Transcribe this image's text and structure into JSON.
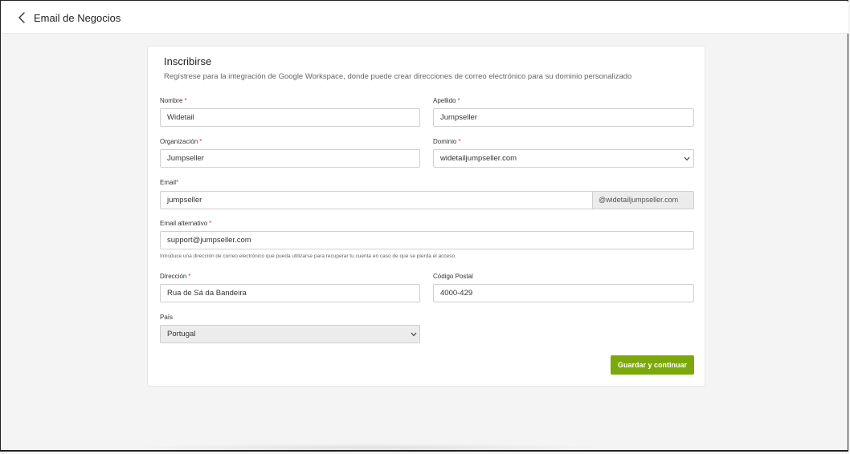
{
  "header": {
    "title": "Email de Negocios"
  },
  "form": {
    "title": "Inscribirse",
    "description": "Regístrese para la integración de Google Workspace, donde puede crear direcciones de correo electrónico para su dominio personalizado",
    "required_mark": "*",
    "fields": {
      "nombre": {
        "label": "Nombre",
        "value": "Widetail"
      },
      "apellido": {
        "label": "Apellido",
        "value": "Jumpseller"
      },
      "organizacion": {
        "label": "Organización",
        "value": "Jumpseller"
      },
      "dominio": {
        "label": "Dominio",
        "value": "widetailjumpseller.com"
      },
      "email": {
        "label": "Email",
        "value": "jumpseller",
        "suffix": "@widetailjumpseller.com"
      },
      "email_alternativo": {
        "label": "Email alternativo",
        "value": "support@jumpseller.com",
        "help": "Introduce una dirección de correo electrónico que pueda utilizarse para recuperar tu cuenta en caso de que se pierda el acceso."
      },
      "direccion": {
        "label": "Dirección",
        "value": "Rua de Sá da Bandeira"
      },
      "codigo_postal": {
        "label": "Código Postal",
        "value": "4000-429"
      },
      "pais": {
        "label": "País",
        "value": "Portugal"
      }
    },
    "submit_label": "Guardar y continuar"
  },
  "colors": {
    "accent": "#7ca80c",
    "required": "#dd3333"
  },
  "icons": {
    "back": "chevron-left-icon",
    "select": "chevron-down-icon"
  }
}
